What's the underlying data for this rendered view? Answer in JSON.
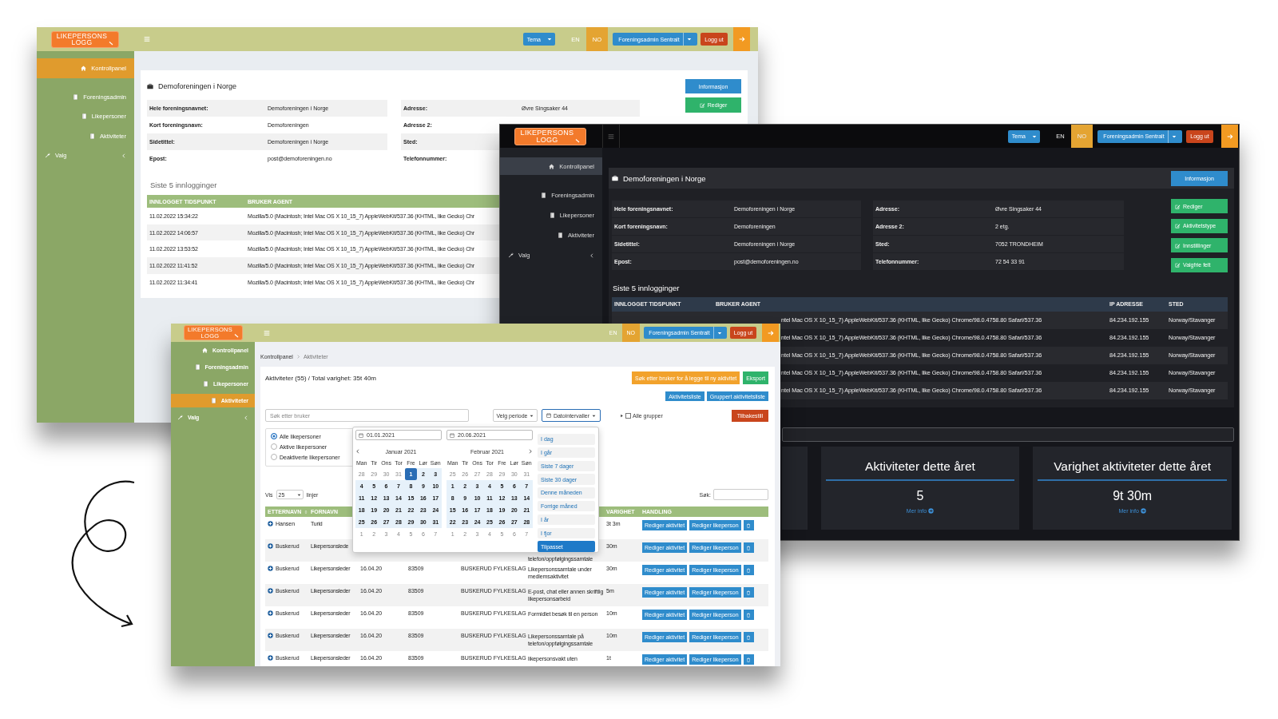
{
  "back_window": {
    "logo": {
      "lines": [
        "LIKEPERSONS",
        "LOGG"
      ]
    },
    "header": {
      "theme_button": "Tema",
      "languages": [
        {
          "label": "EN",
          "selected": false
        },
        {
          "label": "NO",
          "selected": true
        }
      ],
      "account_button": "Foreningsadmin Sentralt",
      "logout_button": "Logg ut"
    },
    "sidebar": [
      {
        "label": "Kontrollpanel",
        "selected": true
      },
      {
        "label": "Foreningsadmin",
        "selected": false
      },
      {
        "label": "Likepersoner",
        "selected": false
      },
      {
        "label": "Aktiviteter",
        "selected": false
      },
      {
        "label": "Valg",
        "selected": false,
        "has_submenu": true
      }
    ],
    "org_card": {
      "title": "Demoforeningen i Norge",
      "info_button": "Informasjon",
      "actions": [
        "Rediger"
      ],
      "info_left": [
        {
          "label": "Hele foreningsnavnet:",
          "value": "Demoforeningen i Norge"
        },
        {
          "label": "Kort foreningsnavn:",
          "value": "Demoforeningen"
        },
        {
          "label": "Sidetittel:",
          "value": "Demoforeningen i Norge"
        },
        {
          "label": "Epost:",
          "value": "post@demoforeningen.no"
        }
      ],
      "info_right": [
        {
          "label": "Adresse:",
          "value": "Øvre Singsaker 44"
        },
        {
          "label": "Adresse 2:"
        },
        {
          "label": "Sted:"
        },
        {
          "label": "Telefonnummer:"
        }
      ]
    },
    "logins": {
      "title": "Siste 5 innlogginger",
      "columns": [
        "INNLOGGET TIDSPUNKT",
        "BRUKER AGENT"
      ],
      "rows": [
        [
          "11.02.2022 15:34:22",
          "Mozilla/5.0 (Macintosh; Intel Mac OS X 10_15_7) AppleWebKit/537.36 (KHTML, like Gecko) Chr"
        ],
        [
          "11.02.2022 14:06:57",
          "Mozilla/5.0 (Macintosh; Intel Mac OS X 10_15_7) AppleWebKit/537.36 (KHTML, like Gecko) Chr"
        ],
        [
          "11.02.2022 13:53:52",
          "Mozilla/5.0 (Macintosh; Intel Mac OS X 10_15_7) AppleWebKit/537.36 (KHTML, like Gecko) Chr"
        ],
        [
          "11.02.2022 11:41:52",
          "Mozilla/5.0 (Macintosh; Intel Mac OS X 10_15_7) AppleWebKit/537.36 (KHTML, like Gecko) Chr"
        ],
        [
          "11.02.2022 11:34:41",
          "Mozilla/5.0 (Macintosh; Intel Mac OS X 10_15_7) AppleWebKit/537.36 (KHTML, like Gecko) Chr"
        ]
      ]
    }
  },
  "dark_window": {
    "logo": {
      "lines": [
        "LIKEPERSONS",
        "LOGG"
      ]
    },
    "header": {
      "theme_button": "Tema",
      "languages": [
        {
          "label": "EN",
          "selected": false
        },
        {
          "label": "NO",
          "selected": true
        }
      ],
      "account_button": "Foreningsadmin Sentralt",
      "logout_button": "Logg ut"
    },
    "sidebar": [
      {
        "label": "Kontrollpanel",
        "selected": true
      },
      {
        "label": "Foreningsadmin",
        "selected": false
      },
      {
        "label": "Likepersoner",
        "selected": false
      },
      {
        "label": "Aktiviteter",
        "selected": false
      },
      {
        "label": "Valg",
        "selected": false,
        "has_submenu": true
      }
    ],
    "org_card": {
      "title": "Demoforeningen i Norge",
      "info_button": "Informasjon",
      "actions": [
        "Rediger",
        "Aktivitetstype",
        "Innstillinger",
        "Valgfrie felt"
      ],
      "info_left": [
        {
          "label": "Hele foreningsnavnet:",
          "value": "Demoforeningen i Norge"
        },
        {
          "label": "Kort foreningsnavn:",
          "value": "Demoforeningen"
        },
        {
          "label": "Sidetittel:",
          "value": "Demoforeningen i Norge"
        },
        {
          "label": "Epost:",
          "value": "post@demoforeningen.no"
        }
      ],
      "info_right": [
        {
          "label": "Adresse:",
          "value": "Øvre Singsaker 44"
        },
        {
          "label": "Adresse 2:",
          "value": "2 etg."
        },
        {
          "label": "Sted:",
          "value": "7052 TRONDHEIM"
        },
        {
          "label": "Telefonnummer:",
          "value": "72 54 33 91"
        }
      ]
    },
    "logins": {
      "title": "Siste 5 innlogginger",
      "columns": [
        "INNLOGGET TIDSPUNKT",
        "BRUKER AGENT",
        "IP ADRESSE",
        "STED"
      ],
      "rows": [
        [
          "",
          "ntel Mac OS X 10_15_7) AppleWebKit/537.36 (KHTML, like Gecko) Chrome/98.0.4758.80 Safari/537.36",
          "84.234.192.155",
          "Norway/Stavanger"
        ],
        [
          "",
          "ntel Mac OS X 10_15_7) AppleWebKit/537.36 (KHTML, like Gecko) Chrome/98.0.4758.80 Safari/537.36",
          "84.234.192.155",
          "Norway/Stavanger"
        ],
        [
          "",
          "ntel Mac OS X 10_15_7) AppleWebKit/537.36 (KHTML, like Gecko) Chrome/98.0.4758.80 Safari/537.36",
          "84.234.192.155",
          "Norway/Stavanger"
        ],
        [
          "",
          "ntel Mac OS X 10_15_7) AppleWebKit/537.36 (KHTML, like Gecko) Chrome/98.0.4758.80 Safari/537.36",
          "84.234.192.155",
          "Norway/Stavanger"
        ],
        [
          "",
          "ntel Mac OS X 10_15_7) AppleWebKit/537.36 (KHTML, like Gecko) Chrome/98.0.4758.80 Safari/537.36",
          "84.234.192.155",
          "Norway/Stavanger"
        ]
      ]
    },
    "stats": [
      {
        "title": "Aktiviteter dette året",
        "value": "5",
        "link": "Mer info"
      },
      {
        "title": "Varighet aktiviteter dette året",
        "value": "9t 30m",
        "link": "Mer info"
      }
    ]
  },
  "front_window": {
    "logo": {
      "lines": [
        "LIKEPERSONS",
        "LOGG"
      ]
    },
    "header": {
      "languages": [
        {
          "label": "EN",
          "selected": false
        },
        {
          "label": "NO",
          "selected": true
        }
      ],
      "account_button": "Foreningsadmin Sentralt",
      "logout_button": "Logg ut"
    },
    "sidebar": [
      {
        "label": "Kontrollpanel",
        "selected": false
      },
      {
        "label": "Foreningsadmin",
        "selected": false
      },
      {
        "label": "Likepersoner",
        "selected": false
      },
      {
        "label": "Aktiviteter",
        "selected": true
      },
      {
        "label": "Valg",
        "selected": false,
        "has_submenu": true
      }
    ],
    "breadcrumb": [
      "Kontrollpanel",
      "Aktiviteter"
    ],
    "title": "Aktiviteter (55) / Total varighet: 35t 40m",
    "add_button": "Søk etter bruker for å legge til ny aktivitet",
    "export_button": "Eksport",
    "list_buttons": [
      "Aktivitetsliste",
      "Gruppert aktivitetsliste"
    ],
    "search": {
      "placeholder": "Søk etter bruker"
    },
    "period_button": "Velg periode",
    "range_button": "Datointervaller",
    "group_filter": {
      "label": "Alle grupper",
      "checked": false
    },
    "reset_button": "Tilbakestill",
    "status_filter": [
      {
        "label": "Alle likepersoner",
        "selected": true
      },
      {
        "label": "Aktive likepersoner",
        "selected": false
      },
      {
        "label": "Deaktiverte likepersoner",
        "selected": false
      }
    ],
    "page_size": {
      "prefix": "Vis",
      "value": "25",
      "suffix": "linjer"
    },
    "table_search_label": "Søk:",
    "table": {
      "columns": {
        "surname": "ETTERNAVN",
        "first_name": "FORNAVN",
        "duration": "VARIGHET",
        "actions": "HANDLING"
      },
      "rows": [
        {
          "surname": "Hansen",
          "first_name": "Turid",
          "duration": "3t 3m",
          "actions": [
            "Rediger aktivitet",
            "Rediger likeperson"
          ]
        },
        {
          "surname": "Buskerud",
          "first_name": "Likepersonslede",
          "description": "telefon/oppfølgingssamtale",
          "description_cut_above": true,
          "duration": "30m",
          "actions": [
            "Rediger aktivitet",
            "Rediger likeperson"
          ]
        },
        {
          "surname": "Buskerud",
          "first_name": "Likepersonsleder",
          "date": "16.04.20",
          "number": "83509",
          "county": "BUSKERUD FYLKESLAG",
          "description": "Likepersonssamtale under medlemsaktivitet",
          "duration": "30m",
          "actions": [
            "Rediger aktivitet",
            "Rediger likeperson"
          ]
        },
        {
          "surname": "Buskerud",
          "first_name": "Likepersonsleder",
          "date": "16.04.20",
          "number": "83509",
          "county": "BUSKERUD FYLKESLAG",
          "description": "E-post, chat eller annen skriftlig likepersonsarbeid",
          "duration": "5m",
          "actions": [
            "Rediger aktivitet",
            "Rediger likeperson"
          ]
        },
        {
          "surname": "Buskerud",
          "first_name": "Likepersonsleder",
          "date": "16.04.20",
          "number": "83509",
          "county": "BUSKERUD FYLKESLAG",
          "description": "Formidlet besøk til en person",
          "duration": "10m",
          "actions": [
            "Rediger aktivitet",
            "Rediger likeperson"
          ]
        },
        {
          "surname": "Buskerud",
          "first_name": "Likepersonsleder",
          "date": "16.04.20",
          "number": "83509",
          "county": "BUSKERUD FYLKESLAG",
          "description": "Likepersonssamtale på telefon/oppfølgingssamtale",
          "duration": "10m",
          "actions": [
            "Rediger aktivitet",
            "Rediger likeperson"
          ]
        },
        {
          "surname": "Buskerud",
          "first_name": "Likepersonsleder",
          "date": "16.04.20",
          "number": "83509",
          "county": "BUSKERUD FYLKESLAG",
          "description": "likepersonsvakt uten",
          "duration": "1t",
          "actions": [
            "Rediger aktivitet",
            "Rediger likeperson"
          ]
        }
      ]
    },
    "date_picker": {
      "start": "01.01.2021",
      "end": "20.06.2021",
      "months": [
        {
          "title": "Januar 2021",
          "weekdays": [
            "Man",
            "Tir",
            "Ons",
            "Tor",
            "Fre",
            "Lør",
            "Søn"
          ],
          "weeks": [
            [
              {
                "day": "28",
                "kind": "other"
              },
              {
                "day": "29",
                "kind": "other"
              },
              {
                "day": "30",
                "kind": "other"
              },
              {
                "day": "31",
                "kind": "other"
              },
              {
                "day": "1",
                "kind": "start"
              },
              {
                "day": "2",
                "kind": "range"
              },
              {
                "day": "3",
                "kind": "range"
              }
            ],
            [
              {
                "day": "4",
                "kind": "range"
              },
              {
                "day": "5",
                "kind": "range"
              },
              {
                "day": "6",
                "kind": "range"
              },
              {
                "day": "7",
                "kind": "range"
              },
              {
                "day": "8",
                "kind": "range"
              },
              {
                "day": "9",
                "kind": "range"
              },
              {
                "day": "10",
                "kind": "range"
              }
            ],
            [
              {
                "day": "11",
                "kind": "range"
              },
              {
                "day": "12",
                "kind": "range"
              },
              {
                "day": "13",
                "kind": "range"
              },
              {
                "day": "14",
                "kind": "range"
              },
              {
                "day": "15",
                "kind": "range"
              },
              {
                "day": "16",
                "kind": "range"
              },
              {
                "day": "17",
                "kind": "range"
              }
            ],
            [
              {
                "day": "18",
                "kind": "range"
              },
              {
                "day": "19",
                "kind": "range"
              },
              {
                "day": "20",
                "kind": "range"
              },
              {
                "day": "21",
                "kind": "range"
              },
              {
                "day": "22",
                "kind": "range"
              },
              {
                "day": "23",
                "kind": "range"
              },
              {
                "day": "24",
                "kind": "range"
              }
            ],
            [
              {
                "day": "25",
                "kind": "range"
              },
              {
                "day": "26",
                "kind": "range"
              },
              {
                "day": "27",
                "kind": "range"
              },
              {
                "day": "28",
                "kind": "range"
              },
              {
                "day": "29",
                "kind": "range"
              },
              {
                "day": "30",
                "kind": "range"
              },
              {
                "day": "31",
                "kind": "range"
              }
            ],
            [
              {
                "day": "1",
                "kind": "other"
              },
              {
                "day": "2",
                "kind": "other"
              },
              {
                "day": "3",
                "kind": "other"
              },
              {
                "day": "4",
                "kind": "other"
              },
              {
                "day": "5",
                "kind": "other"
              },
              {
                "day": "6",
                "kind": "other"
              },
              {
                "day": "7",
                "kind": "other"
              }
            ]
          ]
        },
        {
          "title": "Februar 2021",
          "weekdays": [
            "Man",
            "Tir",
            "Ons",
            "Tor",
            "Fre",
            "Lør",
            "Søn"
          ],
          "weeks": [
            [
              {
                "day": "25",
                "kind": "other"
              },
              {
                "day": "26",
                "kind": "other"
              },
              {
                "day": "27",
                "kind": "other"
              },
              {
                "day": "28",
                "kind": "other"
              },
              {
                "day": "29",
                "kind": "other"
              },
              {
                "day": "30",
                "kind": "other"
              },
              {
                "day": "31",
                "kind": "other"
              }
            ],
            [
              {
                "day": "1",
                "kind": "range"
              },
              {
                "day": "2",
                "kind": "range"
              },
              {
                "day": "3",
                "kind": "range"
              },
              {
                "day": "4",
                "kind": "range"
              },
              {
                "day": "5",
                "kind": "range"
              },
              {
                "day": "6",
                "kind": "range"
              },
              {
                "day": "7",
                "kind": "range"
              }
            ],
            [
              {
                "day": "8",
                "kind": "range"
              },
              {
                "day": "9",
                "kind": "range"
              },
              {
                "day": "10",
                "kind": "range"
              },
              {
                "day": "11",
                "kind": "range"
              },
              {
                "day": "12",
                "kind": "range"
              },
              {
                "day": "13",
                "kind": "range"
              },
              {
                "day": "14",
                "kind": "range"
              }
            ],
            [
              {
                "day": "15",
                "kind": "range"
              },
              {
                "day": "16",
                "kind": "range"
              },
              {
                "day": "17",
                "kind": "range"
              },
              {
                "day": "18",
                "kind": "range"
              },
              {
                "day": "19",
                "kind": "range"
              },
              {
                "day": "20",
                "kind": "range"
              },
              {
                "day": "21",
                "kind": "range"
              }
            ],
            [
              {
                "day": "22",
                "kind": "range"
              },
              {
                "day": "23",
                "kind": "range"
              },
              {
                "day": "24",
                "kind": "range"
              },
              {
                "day": "25",
                "kind": "range"
              },
              {
                "day": "26",
                "kind": "range"
              },
              {
                "day": "27",
                "kind": "range"
              },
              {
                "day": "28",
                "kind": "range"
              }
            ],
            [
              {
                "day": "1",
                "kind": "other"
              },
              {
                "day": "2",
                "kind": "other"
              },
              {
                "day": "3",
                "kind": "other"
              },
              {
                "day": "4",
                "kind": "other"
              },
              {
                "day": "5",
                "kind": "other"
              },
              {
                "day": "6",
                "kind": "other"
              },
              {
                "day": "7",
                "kind": "other"
              }
            ]
          ]
        }
      ],
      "ranges": [
        {
          "label": "I dag",
          "selected": false
        },
        {
          "label": "I går",
          "selected": false
        },
        {
          "label": "Siste 7 dager",
          "selected": false
        },
        {
          "label": "Siste 30 dager",
          "selected": false
        },
        {
          "label": "Denne måneden",
          "selected": false
        },
        {
          "label": "Forrige måned",
          "selected": false
        },
        {
          "label": "I år",
          "selected": false
        },
        {
          "label": "I fjor",
          "selected": false
        },
        {
          "label": "Tilpasset",
          "selected": true
        }
      ]
    }
  }
}
